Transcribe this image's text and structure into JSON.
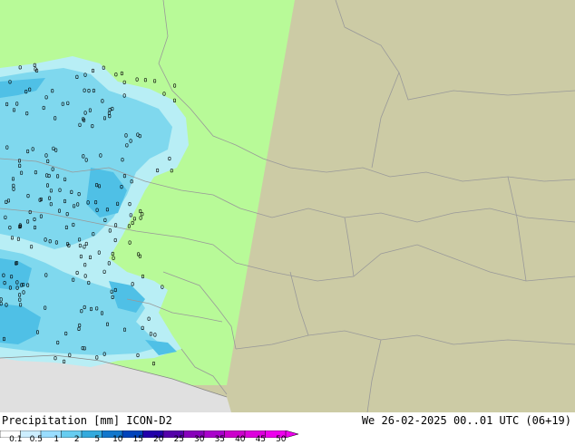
{
  "footer": {
    "title_prefix": "Precipitation [mm]",
    "model": "ICON-D2",
    "datetime": "We 26-02-2025 00..01 UTC (06+19)"
  },
  "legend": {
    "labels": [
      "0.1",
      "0.5",
      "1",
      "2",
      "5",
      "10",
      "15",
      "20",
      "25",
      "30",
      "35",
      "40",
      "45",
      "50"
    ],
    "colors": [
      "#ffffff",
      "#cceeff",
      "#99ddff",
      "#66ccf0",
      "#33aadd",
      "#1177cc",
      "#0044bb",
      "#2200aa",
      "#5500aa",
      "#8800bb",
      "#aa00cc",
      "#cc00cc",
      "#dd00dd",
      "#ee00ee"
    ]
  },
  "map": {
    "colors": {
      "domain": "#b8fa98",
      "outside": "#cccba5",
      "sea": "#e0e0e0",
      "border": "#999999",
      "precip_light": "#b8eef5",
      "precip_mid": "#7fd8ee",
      "precip_heavy": "#4fc0e6"
    }
  }
}
